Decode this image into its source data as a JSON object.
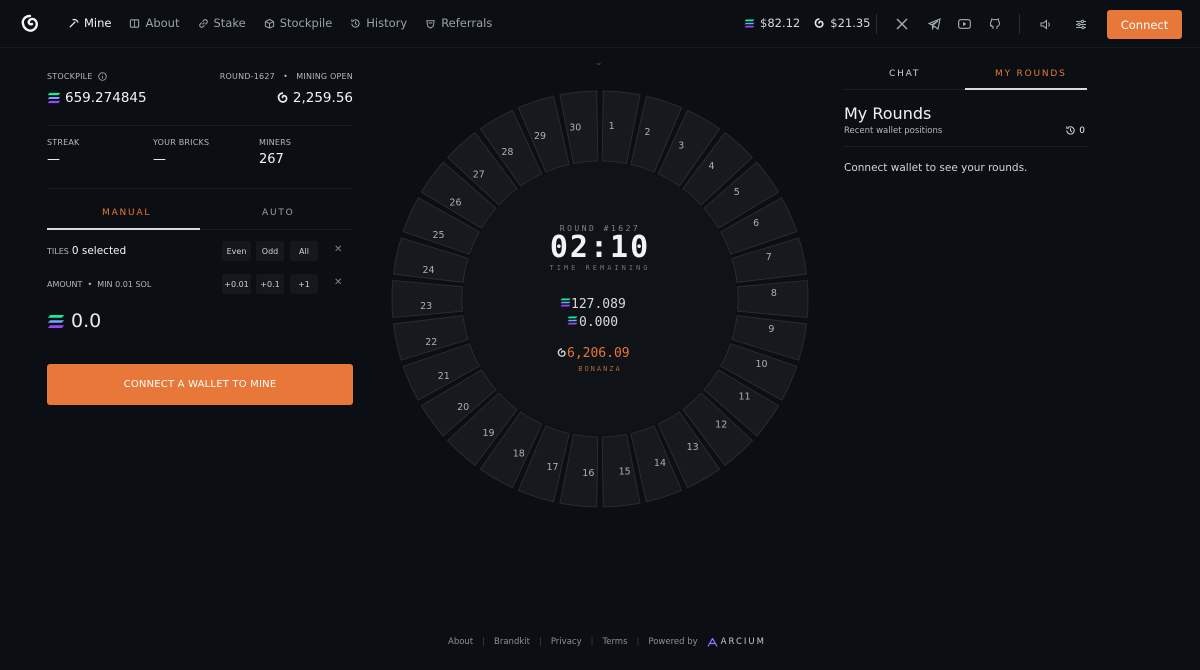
{
  "nav": {
    "items": [
      {
        "label": "Mine",
        "icon": "pickaxe-icon",
        "active": true
      },
      {
        "label": "About",
        "icon": "book-icon",
        "active": false
      },
      {
        "label": "Stake",
        "icon": "link-icon",
        "active": false
      },
      {
        "label": "Stockpile",
        "icon": "box-icon",
        "active": false
      },
      {
        "label": "History",
        "icon": "history-icon",
        "active": false
      },
      {
        "label": "Referrals",
        "icon": "gift-icon",
        "active": false
      }
    ]
  },
  "prices": {
    "sol": "$82.12",
    "token": "$21.35"
  },
  "header": {
    "connect_label": "Connect"
  },
  "left": {
    "stockpile_label": "STOCKPILE",
    "round_label": "ROUND-1627",
    "mining_status": "MINING OPEN",
    "stockpile_value": "659.274845",
    "round_value": "2,259.56",
    "streak_label": "STREAK",
    "streak_value": "—",
    "bricks_label": "YOUR BRICKS",
    "bricks_value": "—",
    "miners_label": "MINERS",
    "miners_value": "267",
    "tab_manual": "MANUAL",
    "tab_auto": "AUTO",
    "tiles_label": "TILES",
    "tiles_selected": "0 selected",
    "chip_even": "Even",
    "chip_odd": "Odd",
    "chip_all": "All",
    "amount_label": "AMOUNT",
    "amount_min": "MIN 0.01 SOL",
    "chip_001": "+0.01",
    "chip_01": "+0.1",
    "chip_1": "+1",
    "amount_value": "0.0",
    "cta_label": "CONNECT A WALLET TO MINE"
  },
  "wheel": {
    "tiles": [
      "1",
      "2",
      "3",
      "4",
      "5",
      "6",
      "7",
      "8",
      "9",
      "10",
      "11",
      "12",
      "13",
      "14",
      "15",
      "16",
      "17",
      "18",
      "19",
      "20",
      "21",
      "22",
      "23",
      "24",
      "25",
      "26",
      "27",
      "28",
      "29",
      "30"
    ],
    "round_label": "ROUND #1627",
    "timer": "02:10",
    "time_label": "TIME REMAINING",
    "sol_total": "127.089",
    "sol_mine": "0.000",
    "bonanza_value": "6,206.09",
    "bonanza_label": "BONANZA"
  },
  "right": {
    "tab_chat": "CHAT",
    "tab_my_rounds": "MY ROUNDS",
    "title": "My Rounds",
    "subtitle": "Recent wallet positions",
    "count": "0",
    "empty_text": "Connect wallet to see your rounds."
  },
  "footer": {
    "links": [
      "About",
      "Brandkit",
      "Privacy",
      "Terms"
    ],
    "powered_by": "Powered by",
    "brand": "ARCIUM"
  },
  "colors": {
    "accent": "#e8773a",
    "background": "#0b0e12",
    "tile": "#16191d",
    "tile_border": "#272c33"
  }
}
